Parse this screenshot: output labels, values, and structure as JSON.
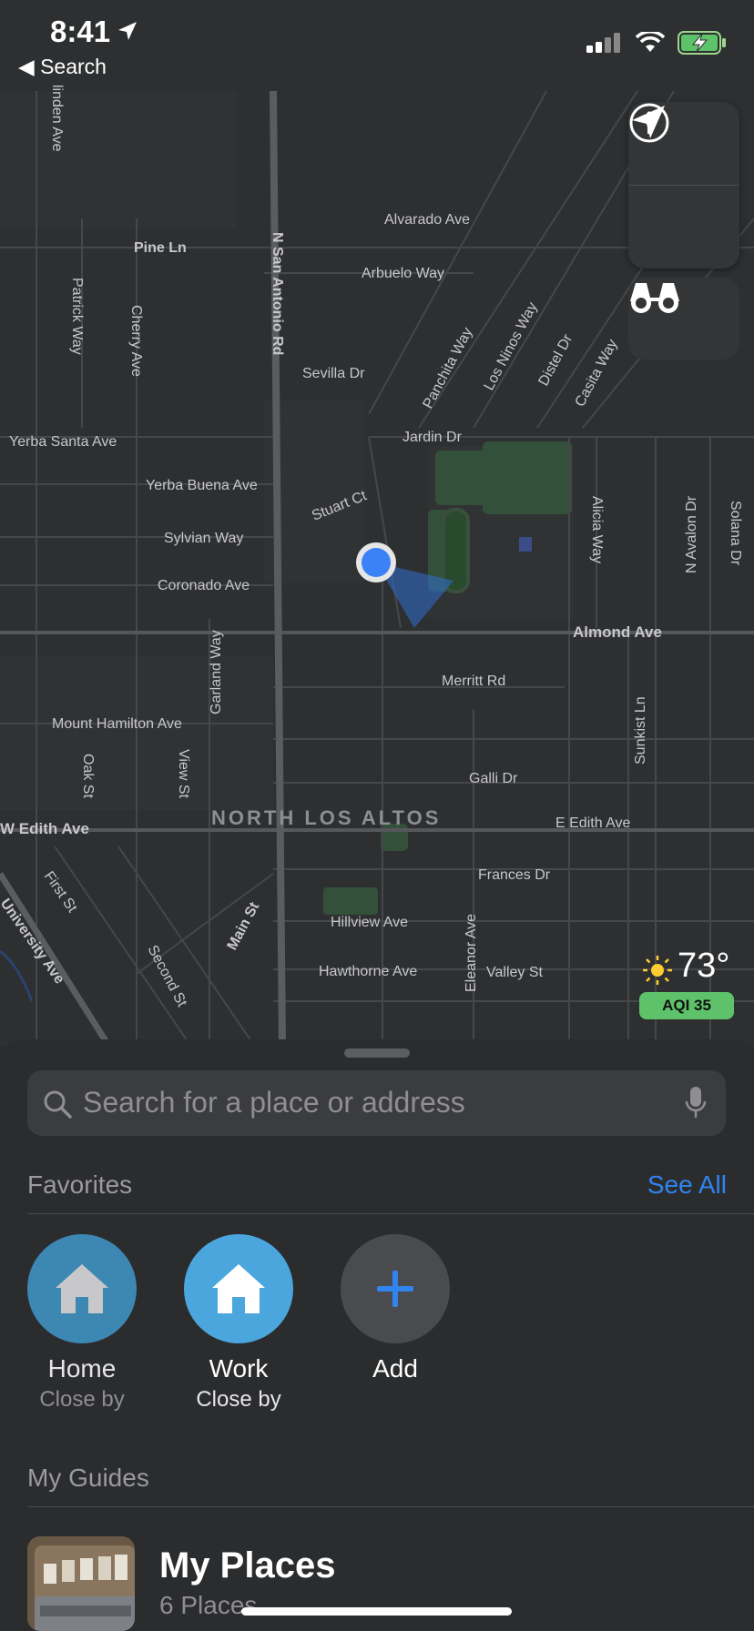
{
  "status": {
    "time": "8:41",
    "back_label": "Search"
  },
  "map": {
    "streets": [
      "Alvarado Ave",
      "Arbuelo Way",
      "Pine Ln",
      "Patrick Way",
      "Cherry Ave",
      "N San Antonio Rd",
      "Sevilla Dr",
      "Panchita Way",
      "Los Ninos Way",
      "Distel Dr",
      "Casita Way",
      "Yerba Santa Ave",
      "Jardin Dr",
      "Yerba Buena Ave",
      "Stuart Ct",
      "Sylvian Way",
      "Coronado Ave",
      "Alicia Way",
      "N Avalon Dr",
      "Solana Dr",
      "Almond Ave",
      "Merritt Rd",
      "Garland Way",
      "Mount Hamilton Ave",
      "Sunkist Ln",
      "Galli Dr",
      "Oak St",
      "View St",
      "W Edith Ave",
      "E Edith Ave",
      "Frances Dr",
      "First St",
      "Main St",
      "Hillview Ave",
      "Eleanor Ave",
      "Hawthorne Ave",
      "Valley St",
      "Second St",
      "University Ave",
      "linden Ave"
    ],
    "district_label": "NORTH LOS ALTOS",
    "controls": [
      "info-icon",
      "location-arrow-icon",
      "binoculars-icon"
    ]
  },
  "weather": {
    "temperature": "73°",
    "aqi": "AQI 35",
    "icon": "sun-icon"
  },
  "sheet": {
    "search_placeholder": "Search for a place or address",
    "favorites_heading": "Favorites",
    "see_all": "See All",
    "favorites": [
      {
        "title": "Home",
        "subtitle": "Close by",
        "icon": "house-icon",
        "color": "#3d87b3"
      },
      {
        "title": "Work",
        "subtitle": "Close by",
        "icon": "house-icon",
        "color": "#4aa6dd"
      },
      {
        "title": "Add",
        "subtitle": "",
        "icon": "plus-icon",
        "color": "#4a4b4e"
      }
    ],
    "guides_heading": "My Guides",
    "guide": {
      "title": "My Places",
      "subtitle": "6 Places"
    }
  },
  "colors": {
    "accent": "#2f84ee",
    "aqi_good": "#5ec26a",
    "user_location": "#3b82f6"
  }
}
